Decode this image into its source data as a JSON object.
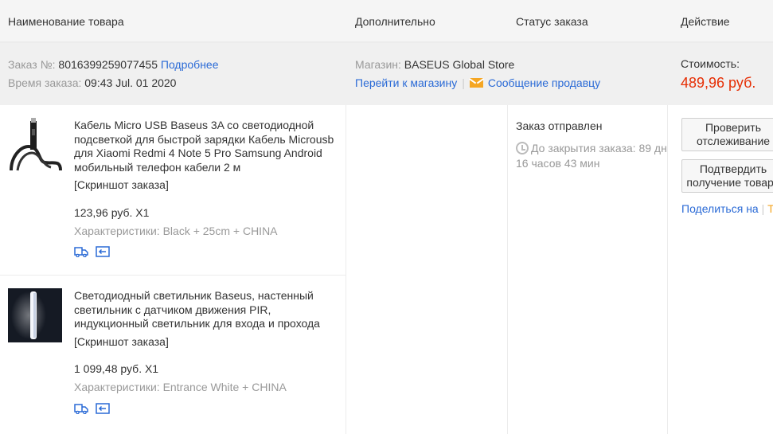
{
  "header": {
    "product_name": "Наименование товара",
    "additional": "Дополнительно",
    "order_status": "Статус заказа",
    "action": "Действие"
  },
  "order": {
    "number_label": "Заказ №:",
    "number_value": "8016399259077455",
    "details_link": "Подробнее",
    "time_label": "Время заказа:",
    "time_value": "09:43 Jul. 01 2020",
    "store_label": "Магазин:",
    "store_name": "BASEUS Global Store",
    "goto_store_link": "Перейти к магазину",
    "separator": "|",
    "message_seller_link": "Сообщение продавцу",
    "cost_label": "Стоимость:",
    "cost_value": "489,96 руб."
  },
  "items": [
    {
      "title": "Кабель Micro USB Baseus 3A со светодиодной подсветкой для быстрой зарядки Кабель Microusb для Xiaomi Redmi 4 Note 5 Pro Samsung Android мобильный телефон кабели 2 м",
      "screenshot_link": "[Скриншот заказа]",
      "price_qty": "123,96 руб. X1",
      "specs": "Характеристики: Black + 25cm + CHINA"
    },
    {
      "title": "Светодиодный светильник Baseus, настенный светильник с датчиком движения PIR, индукционный светильник для входа и прохода",
      "screenshot_link": "[Скриншот заказа]",
      "price_qty": "1 099,48 руб. X1",
      "specs": "Характеристики: Entrance White + CHINA"
    }
  ],
  "status": {
    "text": "Заказ отправлен",
    "timer": "До закрытия заказа: 89 дн 16 часов 43 мин"
  },
  "actions": {
    "track_button": "Проверить отслеживание",
    "confirm_button": "Подтвердить получение товара",
    "share_link": "Поделиться на",
    "share_sep": "|",
    "share_tail": "Т"
  },
  "colors": {
    "link": "#2a6ad6",
    "price": "#e62e04",
    "mail_icon": "#f5a623"
  },
  "icons": [
    "truck-icon",
    "return-icon",
    "clock-icon",
    "mail-icon"
  ]
}
